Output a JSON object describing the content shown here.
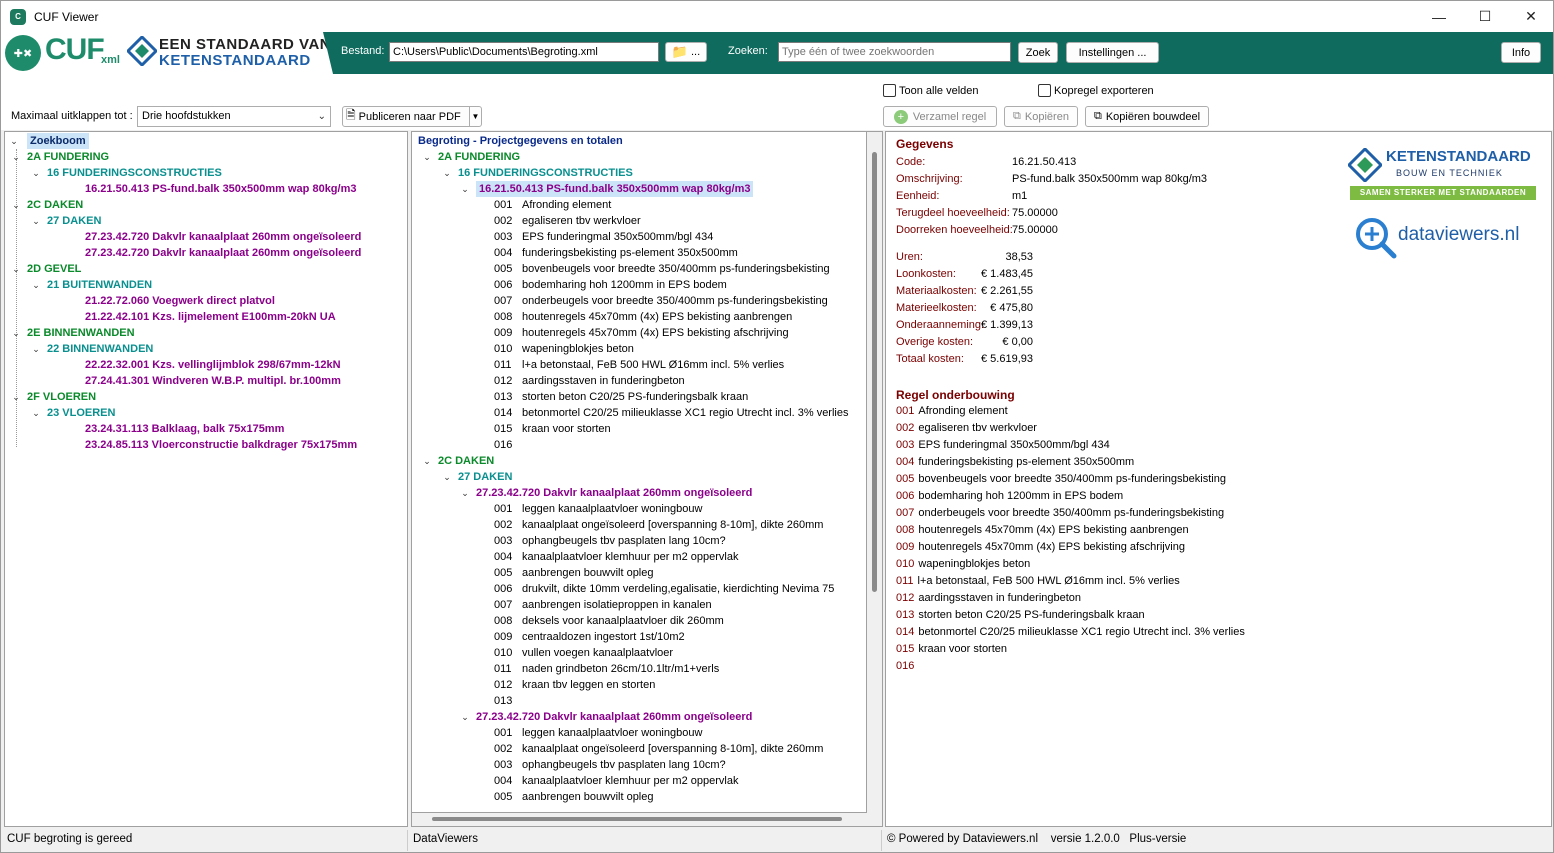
{
  "window": {
    "title": "CUF Viewer"
  },
  "header": {
    "logo_cuf": "CUF",
    "logo_xml": "xml",
    "logo_line1": "EEN STANDAARD VAN",
    "logo_line2": "KETENSTANDAARD",
    "bestand_label": "Bestand:",
    "bestand_value": "C:\\Users\\Public\\Documents\\Begroting.xml",
    "browse_label": "...",
    "zoeken_label": "Zoeken:",
    "zoeken_placeholder": "Type één of twee zoekwoorden",
    "zoek_button": "Zoek",
    "instellingen_button": "Instellingen ...",
    "info_button": "Info"
  },
  "toolbar": {
    "maximaal_label": "Maximaal uitklappen tot :",
    "maximaal_value": "Drie hoofdstukken",
    "publiceren_label": "Publiceren naar PDF",
    "toon_alle_velden": "Toon alle velden",
    "kopregel_exporteren": "Kopregel exporteren",
    "verzamel_regel": "Verzamel regel",
    "kopieren": "Kopiëren",
    "kopieren_bouwdeel": "Kopiëren bouwdeel"
  },
  "left_tree": {
    "root": "Zoekboom",
    "rows": [
      {
        "level": 1,
        "text": "2A FUNDERING"
      },
      {
        "level": 2,
        "text": "16 FUNDERINGSCONSTRUCTIES"
      },
      {
        "level": 3,
        "text": "16.21.50.413 PS-fund.balk 350x500mm wap 80kg/m3"
      },
      {
        "level": 1,
        "text": "2C DAKEN"
      },
      {
        "level": 2,
        "text": "27 DAKEN"
      },
      {
        "level": 3,
        "text": "27.23.42.720 Dakvlr kanaalplaat 260mm ongeïsoleerd"
      },
      {
        "level": 3,
        "text": "27.23.42.720 Dakvlr kanaalplaat 260mm ongeïsoleerd"
      },
      {
        "level": 1,
        "text": "2D GEVEL"
      },
      {
        "level": 2,
        "text": "21 BUITENWANDEN"
      },
      {
        "level": 3,
        "text": "21.22.72.060 Voegwerk direct platvol"
      },
      {
        "level": 3,
        "text": "21.22.42.101 Kzs. lijmelement E100mm-20kN UA"
      },
      {
        "level": 1,
        "text": "2E BINNENWANDEN"
      },
      {
        "level": 2,
        "text": "22 BINNENWANDEN"
      },
      {
        "level": 3,
        "text": "22.22.32.001 Kzs. vellinglijmblok 298/67mm-12kN"
      },
      {
        "level": 3,
        "text": "27.24.41.301 Windveren W.B.P. multipl. br.100mm"
      },
      {
        "level": 1,
        "text": "2F VLOEREN"
      },
      {
        "level": 2,
        "text": "23 VLOEREN"
      },
      {
        "level": 3,
        "text": "23.24.31.113 Balklaag, balk 75x175mm"
      },
      {
        "level": 3,
        "text": "23.24.85.113 Vloerconstructie balkdrager 75x175mm"
      }
    ]
  },
  "mid_tree": {
    "root": "Begroting - Projectgegevens en totalen",
    "rows": [
      {
        "level": 1,
        "text": "2A FUNDERING"
      },
      {
        "level": 2,
        "text": "16 FUNDERINGSCONSTRUCTIES"
      },
      {
        "level": 3,
        "text": "16.21.50.413 PS-fund.balk 350x500mm wap 80kg/m3",
        "selected": true
      },
      {
        "level": 4,
        "num": "001",
        "text": "Afronding element"
      },
      {
        "level": 4,
        "num": "002",
        "text": "egaliseren tbv werkvloer"
      },
      {
        "level": 4,
        "num": "003",
        "text": "EPS funderingmal 350x500mm/bgl 434"
      },
      {
        "level": 4,
        "num": "004",
        "text": "funderingsbekisting ps-element 350x500mm"
      },
      {
        "level": 4,
        "num": "005",
        "text": "bovenbeugels voor breedte 350/400mm ps-funderingsbekisting"
      },
      {
        "level": 4,
        "num": "006",
        "text": "bodemharing hoh 1200mm in EPS bodem"
      },
      {
        "level": 4,
        "num": "007",
        "text": "onderbeugels voor breedte 350/400mm ps-funderingsbekisting"
      },
      {
        "level": 4,
        "num": "008",
        "text": "houtenregels 45x70mm (4x) EPS bekisting aanbrengen"
      },
      {
        "level": 4,
        "num": "009",
        "text": "houtenregels 45x70mm (4x) EPS bekisting afschrijving"
      },
      {
        "level": 4,
        "num": "010",
        "text": "wapeningblokjes beton"
      },
      {
        "level": 4,
        "num": "011",
        "text": "l+a betonstaal, FeB 500 HWL Ø16mm incl. 5% verlies"
      },
      {
        "level": 4,
        "num": "012",
        "text": "aardingsstaven in funderingbeton"
      },
      {
        "level": 4,
        "num": "013",
        "text": "storten beton C20/25 PS-funderingsbalk kraan"
      },
      {
        "level": 4,
        "num": "014",
        "text": "betonmortel C20/25 milieuklasse XC1 regio Utrecht incl. 3% verlies"
      },
      {
        "level": 4,
        "num": "015",
        "text": "kraan voor storten"
      },
      {
        "level": 4,
        "num": "016",
        "text": ""
      },
      {
        "level": 1,
        "text": "2C DAKEN"
      },
      {
        "level": 2,
        "text": "27 DAKEN"
      },
      {
        "level": 3,
        "text": "27.23.42.720 Dakvlr kanaalplaat 260mm ongeïsoleerd"
      },
      {
        "level": 4,
        "num": "001",
        "text": "leggen kanaalplaatvloer woningbouw"
      },
      {
        "level": 4,
        "num": "002",
        "text": "kanaalplaat ongeïsoleerd [overspanning 8-10m], dikte 260mm"
      },
      {
        "level": 4,
        "num": "003",
        "text": "ophangbeugels tbv pasplaten lang 10cm?"
      },
      {
        "level": 4,
        "num": "004",
        "text": "kanaalplaatvloer klemhuur per m2 oppervlak"
      },
      {
        "level": 4,
        "num": "005",
        "text": "aanbrengen bouwvilt opleg"
      },
      {
        "level": 4,
        "num": "006",
        "text": "drukvilt, dikte 10mm verdeling,egalisatie, kierdichting Nevima 75"
      },
      {
        "level": 4,
        "num": "007",
        "text": "aanbrengen isolatieproppen in kanalen"
      },
      {
        "level": 4,
        "num": "008",
        "text": "deksels voor kanaalplaatvloer dik 260mm"
      },
      {
        "level": 4,
        "num": "009",
        "text": "centraaldozen ingestort 1st/10m2"
      },
      {
        "level": 4,
        "num": "010",
        "text": "vullen voegen kanaalplaatvloer"
      },
      {
        "level": 4,
        "num": "011",
        "text": "naden grindbeton 26cm/10.1ltr/m1+verls"
      },
      {
        "level": 4,
        "num": "012",
        "text": "kraan tbv leggen en storten"
      },
      {
        "level": 4,
        "num": "013",
        "text": ""
      },
      {
        "level": 3,
        "text": "27.23.42.720 Dakvlr kanaalplaat 260mm ongeïsoleerd"
      },
      {
        "level": 4,
        "num": "001",
        "text": "leggen kanaalplaatvloer woningbouw"
      },
      {
        "level": 4,
        "num": "002",
        "text": "kanaalplaat ongeïsoleerd [overspanning 8-10m], dikte 260mm"
      },
      {
        "level": 4,
        "num": "003",
        "text": "ophangbeugels tbv pasplaten lang 10cm?"
      },
      {
        "level": 4,
        "num": "004",
        "text": "kanaalplaatvloer klemhuur per m2 oppervlak"
      },
      {
        "level": 4,
        "num": "005",
        "text": "aanbrengen bouwvilt opleg"
      }
    ]
  },
  "details": {
    "gegevens_title": "Gegevens",
    "fields": [
      {
        "label": "Code:",
        "value": "16.21.50.413"
      },
      {
        "label": "Omschrijving:",
        "value": "PS-fund.balk 350x500mm wap 80kg/m3"
      },
      {
        "label": "Eenheid:",
        "value": "m1"
      },
      {
        "label": "Terugdeel hoeveelheid:",
        "value": "75.00000"
      },
      {
        "label": "Doorreken hoeveelheid:",
        "value": "75.00000"
      }
    ],
    "costs": [
      {
        "label": "Uren:",
        "value": "38,53"
      },
      {
        "label": "Loonkosten:",
        "value": "€ 1.483,45"
      },
      {
        "label": "Materiaalkosten:",
        "value": "€ 2.261,55"
      },
      {
        "label": "Materieelkosten:",
        "value": "€ 475,80"
      },
      {
        "label": "Onderaanneming:",
        "value": "€ 1.399,13"
      },
      {
        "label": "Overige kosten:",
        "value": "€ 0,00"
      },
      {
        "label": "Totaal kosten:",
        "value": "€ 5.619,93"
      }
    ],
    "onderbouwing_title": "Regel onderbouwing",
    "onderbouwing": [
      {
        "num": "001",
        "text": "Afronding element"
      },
      {
        "num": "002",
        "text": "egaliseren tbv werkvloer"
      },
      {
        "num": "003",
        "text": "EPS funderingmal 350x500mm/bgl 434"
      },
      {
        "num": "004",
        "text": "funderingsbekisting ps-element 350x500mm"
      },
      {
        "num": "005",
        "text": "bovenbeugels voor breedte 350/400mm ps-funderingsbekisting"
      },
      {
        "num": "006",
        "text": "bodemharing hoh 1200mm in EPS bodem"
      },
      {
        "num": "007",
        "text": "onderbeugels voor breedte 350/400mm ps-funderingsbekisting"
      },
      {
        "num": "008",
        "text": "houtenregels 45x70mm (4x) EPS bekisting aanbrengen"
      },
      {
        "num": "009",
        "text": "houtenregels 45x70mm (4x) EPS bekisting afschrijving"
      },
      {
        "num": "010",
        "text": "wapeningblokjes beton"
      },
      {
        "num": "011",
        "text": "l+a betonstaal, FeB 500 HWL Ø16mm incl. 5% verlies"
      },
      {
        "num": "012",
        "text": "aardingsstaven in funderingbeton"
      },
      {
        "num": "013",
        "text": "storten beton C20/25 PS-funderingsbalk kraan"
      },
      {
        "num": "014",
        "text": "betonmortel C20/25 milieuklasse XC1 regio Utrecht incl. 3% verlies"
      },
      {
        "num": "015",
        "text": "kraan voor storten"
      },
      {
        "num": "016",
        "text": ""
      }
    ],
    "logo_kets_title": "KETENSTANDAARD",
    "logo_kets_sub": "BOUW EN TECHNIEK",
    "logo_kets_banner": "SAMEN STERKER MET STANDAARDEN",
    "logo_dv": "dataviewers.nl"
  },
  "status": {
    "left": "CUF begroting is gereed",
    "mid": "DataViewers",
    "right": "© Powered by Dataviewers.nl    versie 1.2.0.0   Plus-versie"
  },
  "colors": {
    "header_green": "#0e6b5e",
    "level1": "#0a8a2a",
    "level2": "#0a8f8f",
    "level3": "#8b008b",
    "label_red": "#7a0000"
  }
}
